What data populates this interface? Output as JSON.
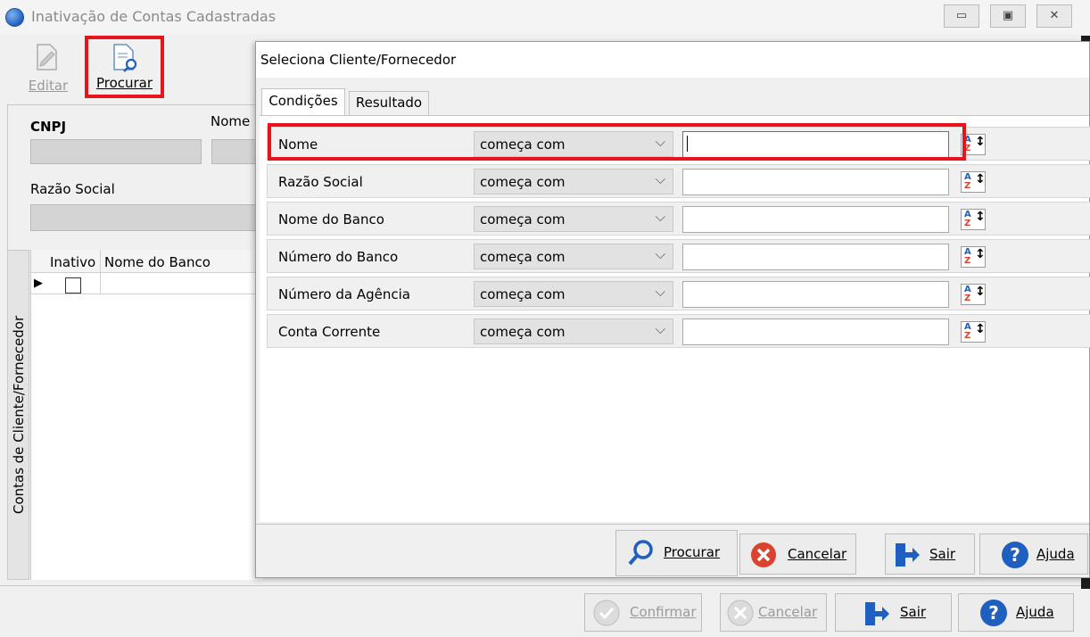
{
  "main_window": {
    "title": "Inativação de Contas Cadastradas",
    "controls": {
      "minimize": "▭",
      "restore": "▣",
      "close": "✕"
    },
    "toolbar": {
      "edit_label": "Editar",
      "search_label": "Procurar"
    },
    "form": {
      "cnpj_label": "CNPJ",
      "nome_label": "Nome F",
      "razao_social_label": "Razão Social"
    },
    "vertical_tab": "Contas de Cliente/Fornecedor",
    "grid": {
      "columns": [
        "Inativo",
        "Nome do Banco"
      ],
      "row_marker": "▶"
    },
    "footer": {
      "confirm_label": "Confirmar",
      "cancel_label": "Cancelar",
      "exit_label": "Sair",
      "help_label": "Ajuda"
    }
  },
  "dialog": {
    "title": "Seleciona Cliente/Fornecedor",
    "tabs": [
      "Condições",
      "Resultado"
    ],
    "conditions": [
      {
        "label": "Nome",
        "operator": "começa com",
        "value": ""
      },
      {
        "label": "Razão Social",
        "operator": "começa com",
        "value": ""
      },
      {
        "label": "Nome do Banco",
        "operator": "começa com",
        "value": ""
      },
      {
        "label": "Número do Banco",
        "operator": "começa com",
        "value": ""
      },
      {
        "label": "Número da Agência",
        "operator": "começa com",
        "value": ""
      },
      {
        "label": "Conta Corrente",
        "operator": "começa com",
        "value": ""
      }
    ],
    "footer": {
      "search_label": "Procurar",
      "cancel_label": "Cancelar",
      "exit_label": "Sair",
      "help_label": "Ajuda"
    }
  },
  "colors": {
    "highlight": "#e8141c",
    "accent_blue": "#1f5fbf",
    "cancel_red": "#d9432f"
  }
}
